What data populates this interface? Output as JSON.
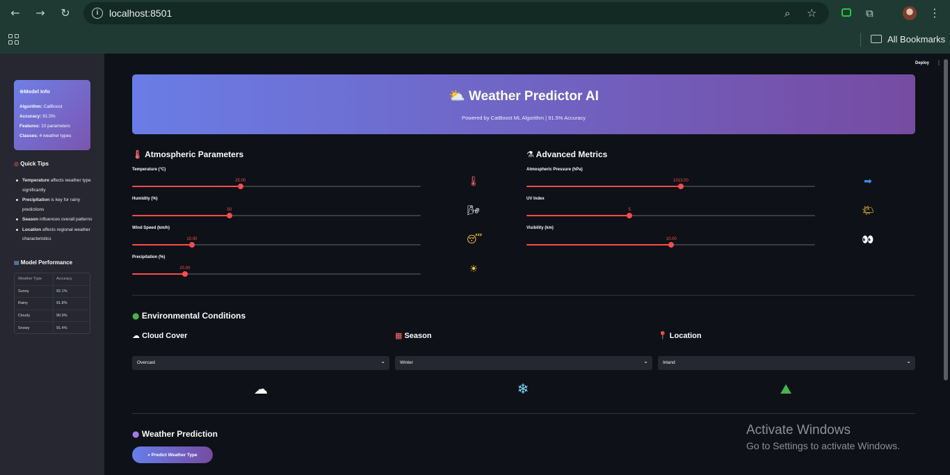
{
  "browser": {
    "url": "localhost:8501",
    "bookmarks_label": "All Bookmarks",
    "icons": [
      "back-arrow-icon",
      "forward-arrow-icon",
      "reload-icon",
      "info-icon",
      "zoom-icon",
      "star-icon",
      "extension-icon",
      "puzzle-icon",
      "avatar",
      "kebab-menu-icon",
      "apps-grid-icon",
      "folder-icon"
    ]
  },
  "sidebar": {
    "model_info": {
      "title": "Model Info",
      "icon": "globe-icon",
      "rows": [
        {
          "key": "Algorithm:",
          "value": "CatBoost"
        },
        {
          "key": "Accuracy:",
          "value": "91.5%"
        },
        {
          "key": "Features:",
          "value": "10 parameters"
        },
        {
          "key": "Classes:",
          "value": "4 weather types"
        }
      ]
    },
    "quick_tips": {
      "title": "Quick Tips",
      "icon": "target-icon",
      "items": [
        {
          "bold": "Temperature",
          "text": "affects weather type significantly"
        },
        {
          "bold": "Precipitation",
          "text": "is key for rainy predictions"
        },
        {
          "bold": "Season",
          "text": "influences overall patterns"
        },
        {
          "bold": "Location",
          "text": "affects regional weather characteristics"
        }
      ]
    },
    "performance": {
      "title": "Model Performance",
      "icon": "chart-icon",
      "headers": [
        "Weather Type",
        "Accuracy"
      ],
      "rows": [
        [
          "Sunny",
          "92.1%"
        ],
        [
          "Rainy",
          "91.8%"
        ],
        [
          "Cloudy",
          "90.9%"
        ],
        [
          "Snowy",
          "91.4%"
        ]
      ]
    }
  },
  "header": {
    "deploy_label": "Deploy",
    "title": "Weather Predictor AI",
    "title_icon": "sun-rain-cloud-icon",
    "subtitle": "Powered by CatBoost ML Algorithm | 91.5% Accuracy"
  },
  "atmospheric": {
    "title": "Atmospheric Parameters",
    "icon": "thermometer-icon",
    "sliders": [
      {
        "label": "Temperature (°C)",
        "value": "25.00",
        "fraction": 0.375,
        "icon": "thermometer-icon",
        "glyph": "🌡"
      },
      {
        "label": "Humidity (%)",
        "value": "50",
        "fraction": 0.337,
        "icon": "wind-face-icon",
        "glyph": "🌬"
      },
      {
        "label": "Wind Speed (km/h)",
        "value": "10.00",
        "fraction": 0.207,
        "icon": "tired-face-icon",
        "glyph": "😴"
      },
      {
        "label": "Precipitation (%)",
        "value": "20.00",
        "fraction": 0.183,
        "icon": "sun-icon",
        "glyph": "☀"
      }
    ]
  },
  "advanced": {
    "title": "Advanced Metrics",
    "icon": "microscope-icon",
    "sliders": [
      {
        "label": "Atmospheric Pressure (hPa)",
        "value": "1013.00",
        "fraction": 0.535,
        "icon": "right-arrow-icon",
        "glyph": "➡"
      },
      {
        "label": "UV Index",
        "value": "5",
        "fraction": 0.357,
        "icon": "sun-behind-cloud-icon",
        "glyph": "🌤"
      },
      {
        "label": "Visibility (km)",
        "value": "10.00",
        "fraction": 0.502,
        "icon": "eyes-icon",
        "glyph": "👀"
      }
    ]
  },
  "environment": {
    "title": "Environmental Conditions",
    "icon": "globe-icon",
    "fields": [
      {
        "label": "Cloud Cover",
        "icon": "cloud-icon",
        "value": "Overcast",
        "big_icon": "cloud-icon",
        "glyph": "☁"
      },
      {
        "label": "Season",
        "icon": "calendar-icon",
        "value": "Winter",
        "big_icon": "snowflake-icon",
        "glyph": "❄"
      },
      {
        "label": "Location",
        "icon": "pin-icon",
        "value": "Inland",
        "big_icon": "mountain-icon",
        "glyph": "⛰"
      }
    ]
  },
  "prediction": {
    "title": "Weather Prediction",
    "icon": "crystal-ball-icon",
    "button_label": "Predict Weather Type",
    "button_icon": "magnifier-icon"
  },
  "watermark": {
    "line1": "Activate Windows",
    "line2": "Go to Settings to activate Windows."
  },
  "colors": {
    "accent": "#ff4b4b",
    "banner_start": "#667eea",
    "banner_end": "#764ba2",
    "sidebar_bg": "#262730",
    "main_bg": "#0e1117"
  }
}
